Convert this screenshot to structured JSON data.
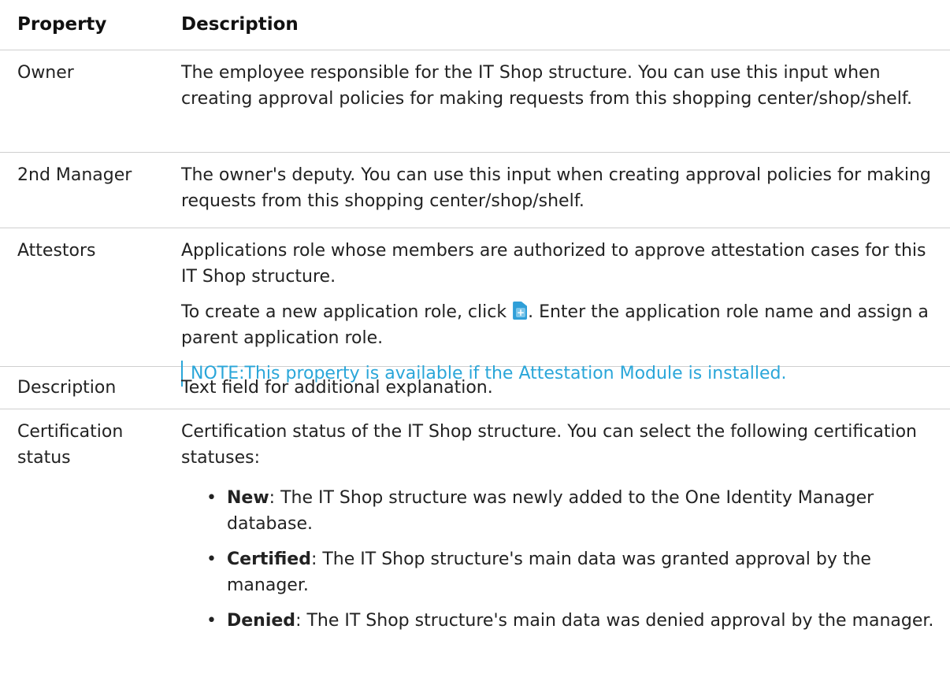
{
  "table": {
    "headers": {
      "property": "Property",
      "description": "Description"
    },
    "rows": [
      {
        "property": "Owner",
        "description": "The employee responsible for the IT Shop structure. You can use this input when creating approval policies for making requests from this shopping center/shop/shelf."
      },
      {
        "property": "2nd Manager",
        "description": "The owner's deputy. You can use this input when creating approval policies for making requests from this shopping center/shop/shelf."
      },
      {
        "property": "Attestors",
        "description": "Applications role whose members are authorized to approve attestation cases for this IT Shop structure.",
        "instruction_before_icon": "To create a new application role, click ",
        "instruction_icon": "add-application-role-icon",
        "instruction_after_icon": ". Enter the application role name and assign a parent application role.",
        "note_label": "NOTE:",
        "note_text": "This property is available if the Attestation Module is installed."
      },
      {
        "property": "Description",
        "description": "Text field for additional explanation."
      },
      {
        "property": "Certification status",
        "description": "Certification status of the IT Shop structure. You can select the following certification statuses:",
        "statuses": [
          {
            "bullet": "•",
            "term": "New",
            "text": ": The IT Shop structure was newly added to the One Identity Manager database."
          },
          {
            "bullet": "•",
            "term": "Certified",
            "text": ": The IT Shop structure's main data was granted approval by the manager."
          },
          {
            "bullet": "•",
            "term": "Denied",
            "text": ": The IT Shop structure's main data was denied approval by the manager."
          }
        ]
      }
    ]
  },
  "colors": {
    "note_accent": "#2aa6d9",
    "icon_blue": "#2f9fd8",
    "divider": "#cfcfcf"
  }
}
